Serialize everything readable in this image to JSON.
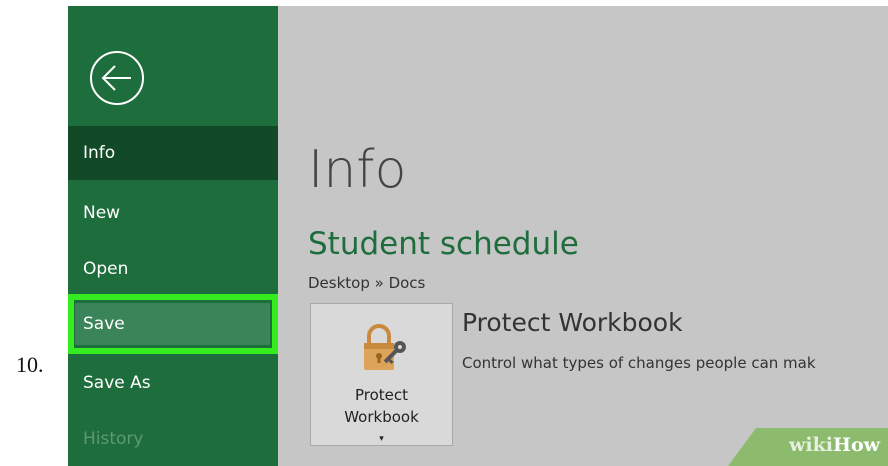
{
  "step_number": "10.",
  "colors": {
    "sidebar_bg": "#1e6d3c",
    "sidebar_active": "#124a28",
    "highlight_border": "#35ec1e",
    "main_bg": "#c6c6c6",
    "accent_text": "#1e6d3c",
    "watermark_bg": "#8dbb6e"
  },
  "sidebar": {
    "back_icon": "back-arrow-icon",
    "items": [
      {
        "label": "Info",
        "state": "active"
      },
      {
        "label": "New",
        "state": "normal"
      },
      {
        "label": "Open",
        "state": "normal"
      },
      {
        "label": "Save",
        "state": "highlighted"
      },
      {
        "label": "Save As",
        "state": "normal"
      },
      {
        "label": "History",
        "state": "disabled"
      }
    ]
  },
  "main": {
    "page_title": "Info",
    "document_title": "Student schedule",
    "document_path": "Desktop » Docs",
    "protect": {
      "button_line1": "Protect",
      "button_line2": "Workbook",
      "caret": "▾",
      "icon": "lock-key-icon",
      "section_title": "Protect Workbook",
      "section_description": "Control what types of changes people can mak"
    }
  },
  "watermark": {
    "part1": "wiki",
    "part2": "How"
  }
}
